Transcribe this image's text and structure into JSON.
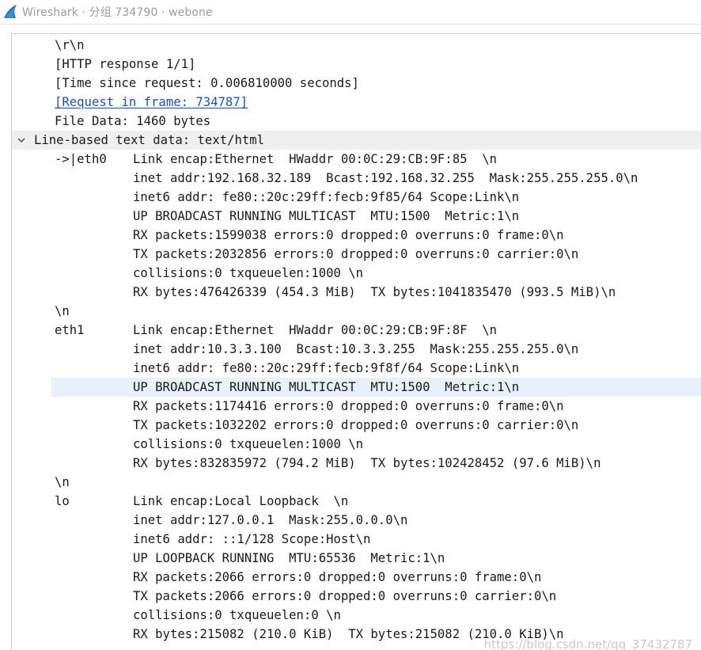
{
  "window": {
    "title": "Wireshark · 分组 734790 · webone",
    "icon": "wireshark-fin-icon",
    "accent": "#1f6fb8"
  },
  "pane": {
    "lines": [
      {
        "col1": "\\r\\n",
        "col2": "",
        "style": ""
      },
      {
        "col1": "[HTTP response 1/1]",
        "col2": "",
        "style": ""
      },
      {
        "col1": "[Time since request: 0.006810000 seconds]",
        "col2": "",
        "style": ""
      },
      {
        "col1": "[Request in frame: 734787]",
        "col2": "",
        "style": "link"
      },
      {
        "col1": "File Data: 1460 bytes",
        "col2": "",
        "style": ""
      },
      {
        "col1": "Line-based text data: text/html",
        "col2": "",
        "style": "header"
      },
      {
        "col1": "->|eth0",
        "col2": "Link encap:Ethernet  HWaddr 00:0C:29:CB:9F:85  \\n",
        "style": "eth0"
      },
      {
        "col1": "",
        "col2": "inet addr:192.168.32.189  Bcast:192.168.32.255  Mask:255.255.255.0\\n",
        "style": ""
      },
      {
        "col1": "",
        "col2": "inet6 addr: fe80::20c:29ff:fecb:9f85/64 Scope:Link\\n",
        "style": ""
      },
      {
        "col1": "",
        "col2": "UP BROADCAST RUNNING MULTICAST  MTU:1500  Metric:1\\n",
        "style": ""
      },
      {
        "col1": "",
        "col2": "RX packets:1599038 errors:0 dropped:0 overruns:0 frame:0\\n",
        "style": ""
      },
      {
        "col1": "",
        "col2": "TX packets:2032856 errors:0 dropped:0 overruns:0 carrier:0\\n",
        "style": ""
      },
      {
        "col1": "",
        "col2": "collisions:0 txqueuelen:1000 \\n",
        "style": ""
      },
      {
        "col1": "",
        "col2": "RX bytes:476426339 (454.3 MiB)  TX bytes:1041835470 (993.5 MiB)\\n",
        "style": ""
      },
      {
        "col1": "\\n",
        "col2": "",
        "style": ""
      },
      {
        "col1": "eth1",
        "col2": "Link encap:Ethernet  HWaddr 00:0C:29:CB:9F:8F  \\n",
        "style": ""
      },
      {
        "col1": "",
        "col2": "inet addr:10.3.3.100  Bcast:10.3.3.255  Mask:255.255.255.0\\n",
        "style": ""
      },
      {
        "col1": "",
        "col2": "inet6 addr: fe80::20c:29ff:fecb:9f8f/64 Scope:Link\\n",
        "style": ""
      },
      {
        "col1": "",
        "col2": "UP BROADCAST RUNNING MULTICAST  MTU:1500  Metric:1\\n",
        "style": "selected"
      },
      {
        "col1": "",
        "col2": "RX packets:1174416 errors:0 dropped:0 overruns:0 frame:0\\n",
        "style": ""
      },
      {
        "col1": "",
        "col2": "TX packets:1032202 errors:0 dropped:0 overruns:0 carrier:0\\n",
        "style": ""
      },
      {
        "col1": "",
        "col2": "collisions:0 txqueuelen:1000 \\n",
        "style": ""
      },
      {
        "col1": "",
        "col2": "RX bytes:832835972 (794.2 MiB)  TX bytes:102428452 (97.6 MiB)\\n",
        "style": ""
      },
      {
        "col1": "\\n",
        "col2": "",
        "style": ""
      },
      {
        "col1": "lo",
        "col2": "Link encap:Local Loopback  \\n",
        "style": ""
      },
      {
        "col1": "",
        "col2": "inet addr:127.0.0.1  Mask:255.0.0.0\\n",
        "style": ""
      },
      {
        "col1": "",
        "col2": "inet6 addr: ::1/128 Scope:Host\\n",
        "style": ""
      },
      {
        "col1": "",
        "col2": "UP LOOPBACK RUNNING  MTU:65536  Metric:1\\n",
        "style": ""
      },
      {
        "col1": "",
        "col2": "RX packets:2066 errors:0 dropped:0 overruns:0 frame:0\\n",
        "style": ""
      },
      {
        "col1": "",
        "col2": "TX packets:2066 errors:0 dropped:0 overruns:0 carrier:0\\n",
        "style": ""
      },
      {
        "col1": "",
        "col2": "collisions:0 txqueuelen:0 \\n",
        "style": ""
      },
      {
        "col1": "",
        "col2": "RX bytes:215082 (210.0 KiB)  TX bytes:215082 (210.0 KiB)\\n",
        "style": ""
      }
    ],
    "expander_icon": "chevron-down-icon",
    "selected_row_color": "#e6f1fb",
    "header_row_color": "#efefef",
    "link_color": "#1d4ed8"
  },
  "watermark": {
    "text": "https://blog.csdn.net/qq_37432787"
  }
}
